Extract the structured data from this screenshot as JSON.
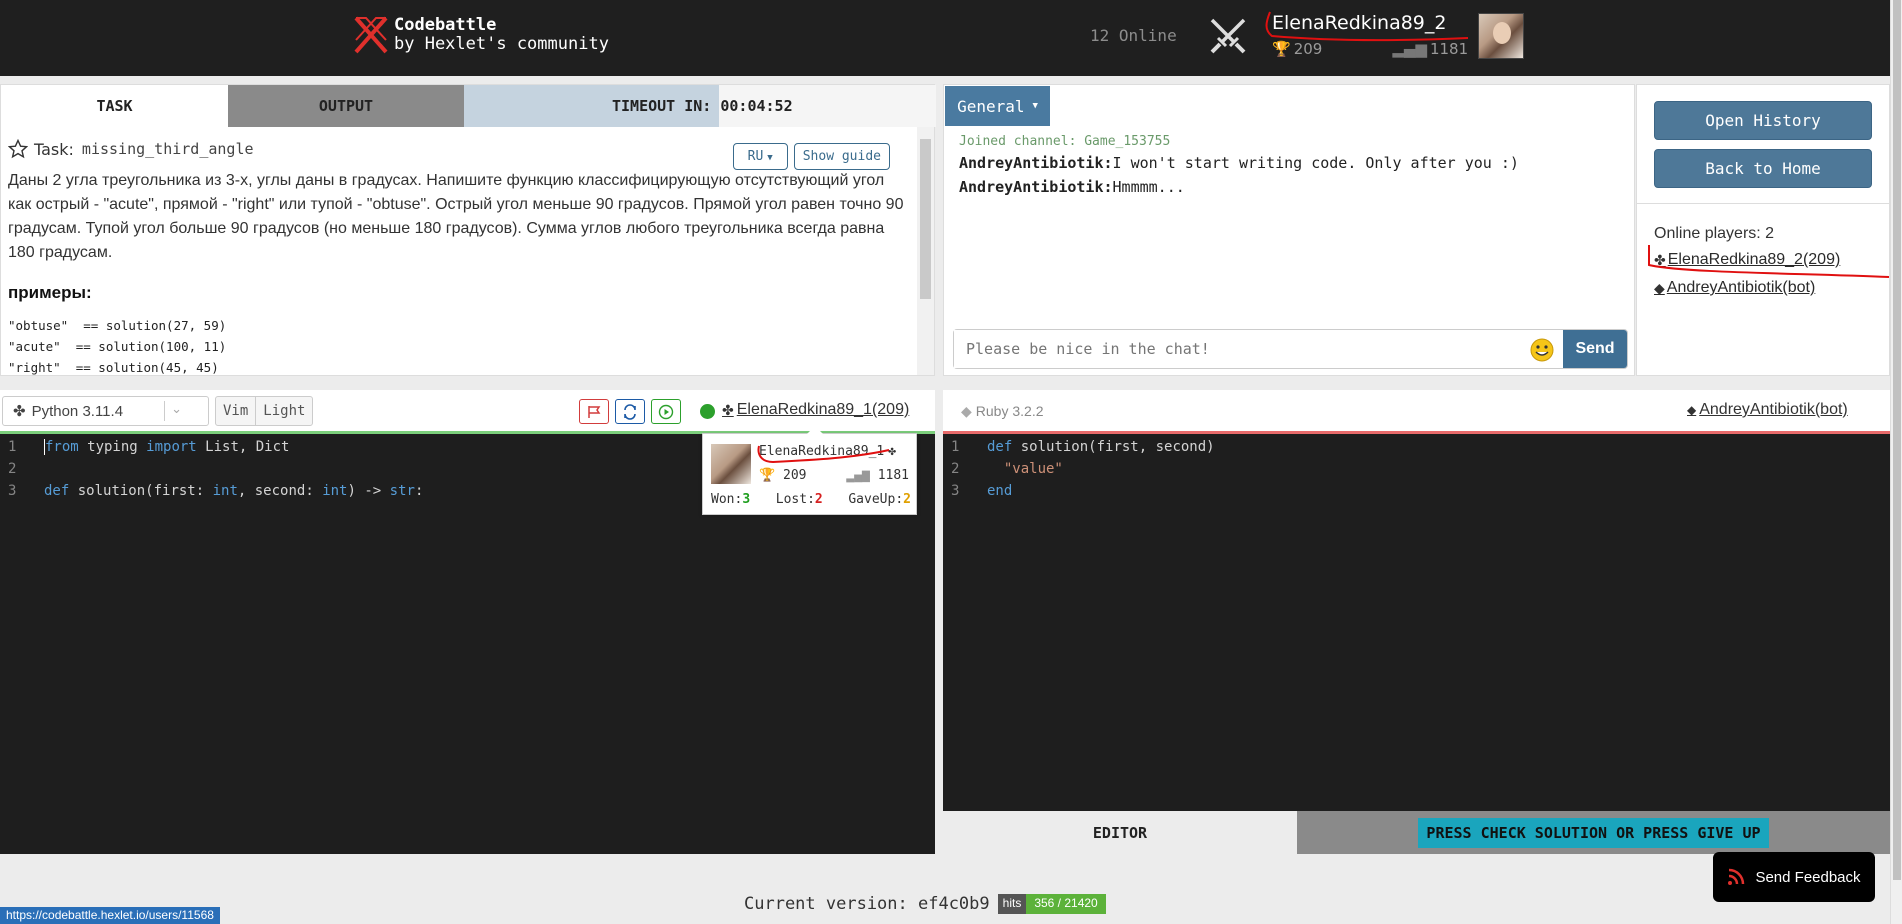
{
  "header": {
    "brand_line1": "Codebattle",
    "brand_line2": "by Hexlet's community",
    "online_text": "12 Online",
    "username": "ElenaRedkina89_2",
    "trophies": "209",
    "rating": "1181"
  },
  "task_panel": {
    "tabs": [
      "TASK",
      "OUTPUT"
    ],
    "timer": "TIMEOUT IN: 00:04:52",
    "timer_progress": 0.54,
    "task_label": "Task:",
    "task_name": "missing_third_angle",
    "lang_button": "RU",
    "guide_button": "Show guide",
    "description": "Даны 2 угла треугольника из 3-х, углы даны в градусах. Напишите функцию классифицирующую отсутствующий угол как острый - \"acute\", прямой - \"right\" или тупой - \"obtuse\". Острый угол меньше 90 градусов. Прямой угол равен точно 90 градусам. Тупой угол больше 90 градусов (но меньше 180 градусов). Сумма углов любого треугольника всегда равна 180 градусам.",
    "examples_heading": "примеры:",
    "examples": [
      "\"obtuse\"  == solution(27, 59)",
      "\"acute\"  == solution(100, 11)",
      "\"right\"  == solution(45, 45)"
    ]
  },
  "chat": {
    "channel": "General",
    "joined": "Joined channel: Game_153755",
    "messages": [
      {
        "author": "AndreyAntibiotik:",
        "text": "I won't start writing code. Only after you :)"
      },
      {
        "author": "AndreyAntibiotik:",
        "text": "Hmmmm..."
      }
    ],
    "input_placeholder": "Please be nice in the chat!",
    "send_label": "Send"
  },
  "side_panel": {
    "open_history": "Open History",
    "back_home": "Back to Home",
    "online_label": "Online players: 2",
    "players": [
      "ElenaRedkina89_2(209)",
      "AndreyAntibiotik(bot)"
    ]
  },
  "editor_left": {
    "language": "Python 3.11.4",
    "mode_vim": "Vim",
    "mode_theme": "Light",
    "player": "ElenaRedkina89_1(209)",
    "lines": [
      "1",
      "2",
      "3"
    ]
  },
  "hover_card": {
    "name": "ElenaRedkina89_1",
    "trophies": "209",
    "rating": "1181",
    "won_label": "Won:",
    "won": "3",
    "lost_label": "Lost:",
    "lost": "2",
    "gaveup_label": "GaveUp:",
    "gaveup": "2"
  },
  "editor_right": {
    "language": "Ruby 3.2.2",
    "player": "AndreyAntibiotik(bot)",
    "lines": [
      "1",
      "2",
      "3"
    ],
    "tab_editor": "EDITOR",
    "tab_output": "PRESS CHECK SOLUTION OR PRESS GIVE UP"
  },
  "footer": {
    "version": "Current version: ef4c0b9",
    "hits_label": "hits",
    "hits_value": "356 / 21420",
    "feedback": "Send Feedback",
    "status_url": "https://codebattle.hexlet.io/users/11568"
  },
  "colors": {
    "header_bg": "#1f1f1f",
    "accent": "#4a7aa0",
    "success": "#2ca02c",
    "danger": "#d62020"
  }
}
